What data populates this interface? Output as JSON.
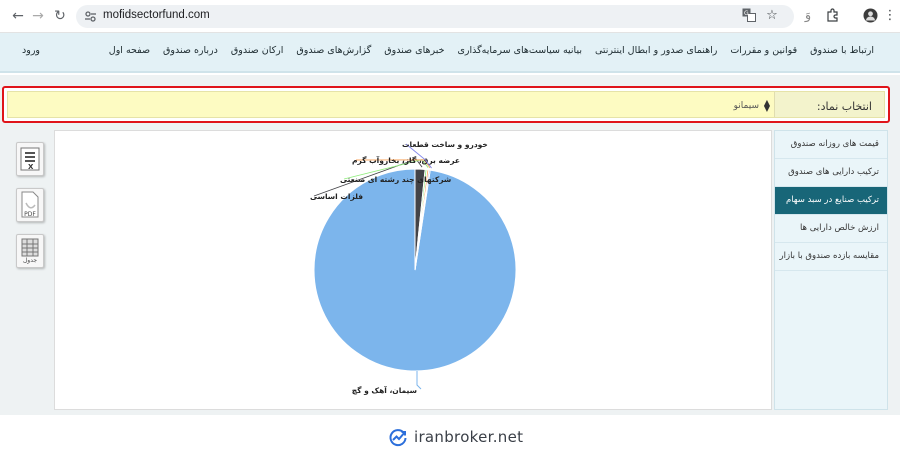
{
  "browser": {
    "url": "mofidsectorfund.com",
    "icons": [
      "back-arrow-icon",
      "forward-arrow-icon",
      "reload-icon",
      "site-info-icon",
      "translate-icon",
      "bookmark-star-icon",
      "extensions-icon",
      "profile-avatar-icon",
      "kebab-menu-icon"
    ]
  },
  "header": {
    "menu": [
      "صفحه اول",
      "درباره صندوق",
      "ارکان صندوق",
      "گزارش‌های صندوق",
      "خبرهای صندوق",
      "بیانیه سیاست‌های سرمایه‌گذاری",
      "راهنمای صدور و ابطال اینترنتی",
      "قوانین و مقررات",
      "ارتباط با صندوق"
    ],
    "login": "ورود"
  },
  "symbol": {
    "label": "انتخاب نماد:",
    "selected": "سیمانو",
    "highlight_color": "#e0141a"
  },
  "tools": [
    {
      "name": "excel-export",
      "label": ""
    },
    {
      "name": "pdf-export",
      "label": "PDF"
    },
    {
      "name": "table-view",
      "label": "جدول"
    }
  ],
  "side_menu": [
    {
      "label": "قیمت های روزانه صندوق",
      "active": false
    },
    {
      "label": "ترکیب دارایی های صندوق",
      "active": false
    },
    {
      "label": "ترکیب صنایع در سبد سهام",
      "active": true
    },
    {
      "label": "ارزش خالص دارایی ها",
      "active": false
    },
    {
      "label": "مقایسه بازده صندوق با بازار",
      "active": false
    }
  ],
  "chart_data": {
    "type": "pie",
    "slices": [
      {
        "label": "سیمان، آهک و گچ",
        "value": 97.6,
        "color": "#7cb5ec"
      },
      {
        "label": "فلزات اساسی",
        "value": 1.6,
        "color": "#434348"
      },
      {
        "label": "شرکتهای چند رشته ای صنعتی",
        "value": 0.3,
        "color": "#90ed7d"
      },
      {
        "label": "عرضه برق، گاز، بخاروآب گرم",
        "value": 0.3,
        "color": "#f7a35c"
      },
      {
        "label": "خودرو و ساخت قطعات",
        "value": 0.2,
        "color": "#8085e9"
      }
    ]
  },
  "footer": {
    "brand": "iranbroker.net"
  }
}
